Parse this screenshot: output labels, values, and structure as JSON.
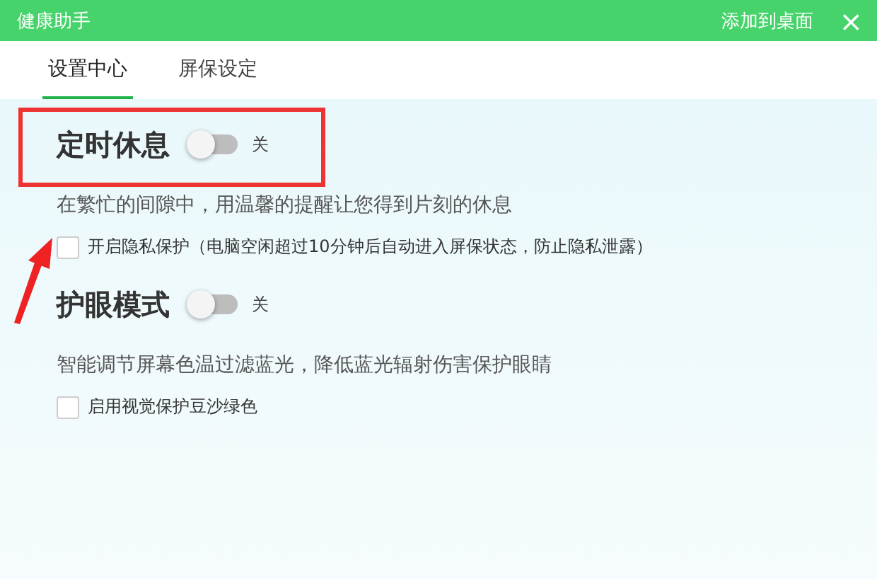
{
  "window": {
    "title": "健康助手",
    "action": "添加到桌面",
    "close": "×"
  },
  "tabs": [
    {
      "label": "设置中心",
      "selected": true
    },
    {
      "label": "屏保设定",
      "selected": false
    }
  ],
  "sections": [
    {
      "title": "定时休息",
      "on": false,
      "state_label": "关",
      "description": "在繁忙的间隙中，用温馨的提醒让您得到片刻的休息",
      "option": {
        "label": "开启隐私保护（电脑空闲超过10分钟后自动进入屏保状态，防止隐私泄露）",
        "checked": false
      }
    },
    {
      "title": "护眼模式",
      "on": false,
      "state_label": "关",
      "description": "智能调节屏幕色温过滤蓝光，降低蓝光辐射伤害保护眼睛",
      "option": {
        "label": "启用视觉保护豆沙绿色",
        "checked": false
      }
    }
  ]
}
